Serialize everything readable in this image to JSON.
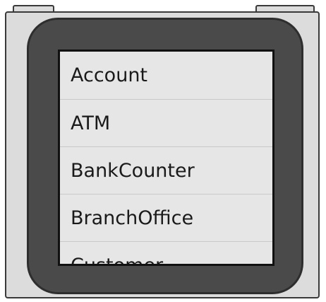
{
  "list": {
    "items": [
      {
        "label": "Account"
      },
      {
        "label": "ATM"
      },
      {
        "label": "BankCounter"
      },
      {
        "label": "BranchOffice"
      },
      {
        "label": "Customer"
      }
    ]
  }
}
